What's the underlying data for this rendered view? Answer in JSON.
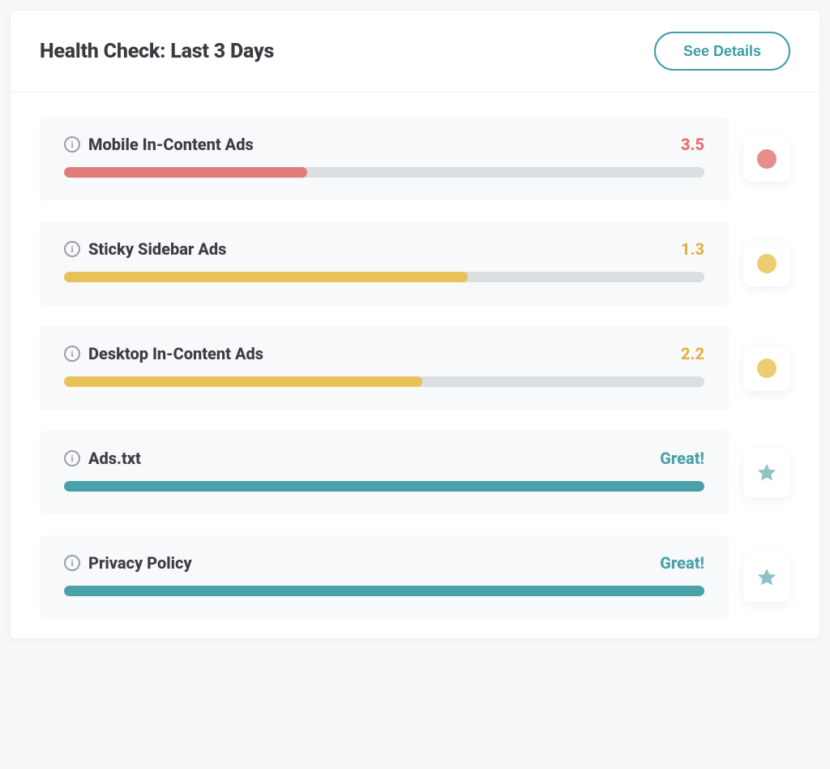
{
  "header": {
    "title": "Health Check: Last 3 Days",
    "see_details_label": "See Details"
  },
  "colors": {
    "red": "#e07b7a",
    "yellow": "#e9c257",
    "teal": "#4aa1a9"
  },
  "rows": [
    {
      "label": "Mobile In-Content Ads",
      "value": "3.5",
      "value_color": "red",
      "progress_pct": 38,
      "progress_color": "red",
      "status_type": "dot",
      "status_color": "red"
    },
    {
      "label": "Sticky Sidebar Ads",
      "value": "1.3",
      "value_color": "yellow",
      "progress_pct": 63,
      "progress_color": "yellow",
      "status_type": "dot",
      "status_color": "yellow"
    },
    {
      "label": "Desktop In-Content Ads",
      "value": "2.2",
      "value_color": "yellow",
      "progress_pct": 56,
      "progress_color": "yellow",
      "status_type": "dot",
      "status_color": "yellow"
    },
    {
      "label": "Ads.txt",
      "value": "Great!",
      "value_color": "teal",
      "progress_pct": 100,
      "progress_color": "teal",
      "status_type": "star",
      "status_color": "teal"
    },
    {
      "label": "Privacy Policy",
      "value": "Great!",
      "value_color": "teal",
      "progress_pct": 100,
      "progress_color": "teal",
      "status_type": "star",
      "status_color": "teal"
    }
  ]
}
